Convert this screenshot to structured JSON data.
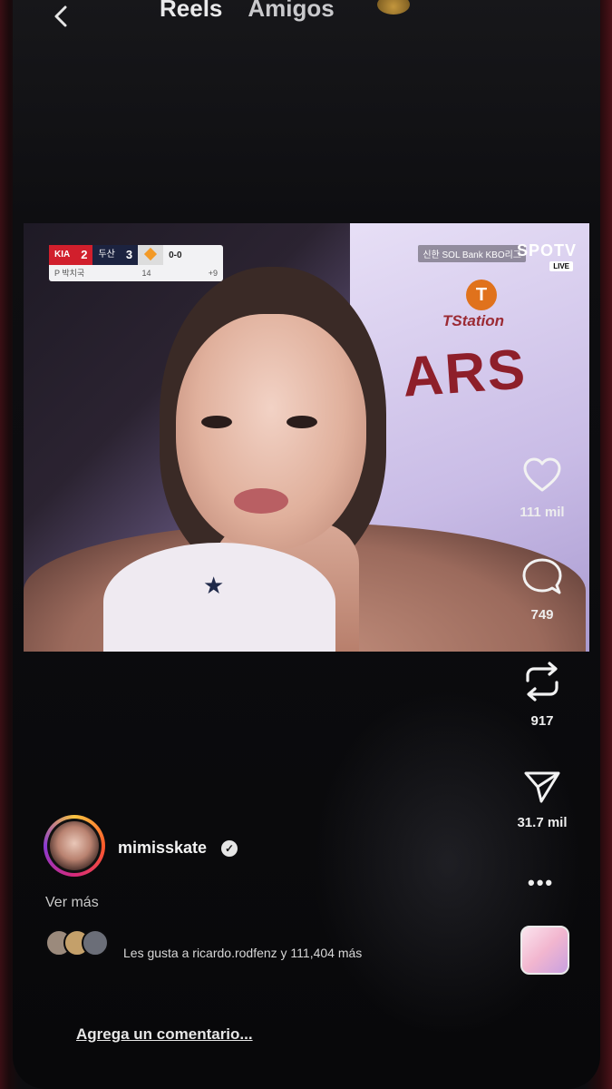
{
  "header": {
    "tabs": [
      {
        "label": "Reels",
        "active": true
      },
      {
        "label": "Amigos",
        "active": false
      }
    ]
  },
  "video": {
    "scoreboard": {
      "team1": "KIA",
      "score1": "2",
      "team2": "두산",
      "score2": "3",
      "count": "0-0",
      "pitcher": "P 박치국",
      "pitch_count": "14",
      "inning": "+9"
    },
    "broadcaster": "신한 SOL Bank KBO리그",
    "channel": "SPOTV",
    "live": "LIVE",
    "jersey_brand": "TStation",
    "jersey_text": "ARS"
  },
  "actions": {
    "likes": "111 mil",
    "comments": "749",
    "reposts": "917",
    "shares": "31.7 mil"
  },
  "post": {
    "username": "mimisskate",
    "ver_mas": "Ver más",
    "likes_text": "Les gusta a ricardo.rodfenz y 111,404 más",
    "comment_placeholder": "Agrega un comentario..."
  },
  "colors": {
    "background": "#0b0b0d",
    "accent_red": "#d11f2c",
    "text": "#ffffff"
  }
}
